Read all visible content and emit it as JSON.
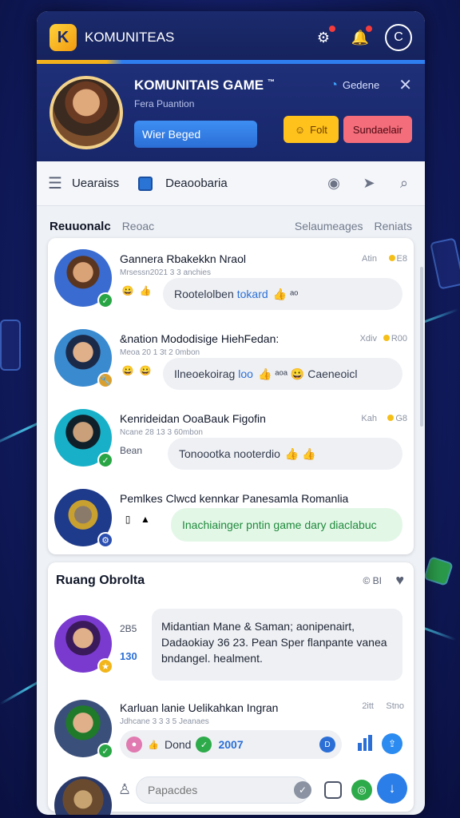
{
  "app": {
    "title": "KOMUNITEAS",
    "logo_icon": "game-logo-icon",
    "top_icons": [
      "settings-icon",
      "notification-icon",
      "profile-circle-icon"
    ],
    "profile_circle_glyph": "C"
  },
  "profile": {
    "name": "KOMUNITAIS GAME",
    "name_mark": "™",
    "subtitle": "Fera Puantion",
    "field_value": "Wier Beged",
    "status_label": "Gedene",
    "follow_label": "Folt",
    "subscribe_label": "Sundaelair",
    "colors": {
      "follow": "#ffc21c",
      "subscribe": "#f46d7a",
      "field": "#2b6fd6"
    }
  },
  "nav": {
    "label1": "Uearaiss",
    "label2": "Deaoobaria",
    "icons": [
      "hamburger-icon",
      "book-icon",
      "shield-icon",
      "pin-icon",
      "search-icon"
    ]
  },
  "subtabs": {
    "active": "Reuuonalc",
    "second": "Reoac",
    "right1": "Selaumeages",
    "right2": "Reniats"
  },
  "posts": [
    {
      "title": "Gannera Rbakekkn Nraol",
      "subtitle": "Mrsessn2021 3 3 anchies",
      "time": "Atin",
      "count": "E8",
      "reactions": [
        "😀",
        "👍"
      ],
      "text": "Rootelolben",
      "highlight": "tokard",
      "emoji": "👍 ᵃᵒ",
      "badge": "✓"
    },
    {
      "title": "&nation Mododisige HiehFedan:",
      "subtitle": "Meoa 20 1 3t 2 0mbon",
      "time": "Xdiv",
      "count": "R00",
      "reactions": [
        "😀",
        "😀"
      ],
      "text": "Ilneoekoirag",
      "highlight": "loo",
      "emoji": "👍 ᵃᵒᵃ 😀 Caeneoicl",
      "badge": "🔧"
    },
    {
      "title": "Kenrideidan OoaBauk Figofin",
      "subtitle": "Ncane 28 13 3 60mbon",
      "time": "Kah",
      "count": "G8",
      "reactions": [
        "Bean"
      ],
      "text": "Tonoootka nooterdio",
      "highlight": "",
      "emoji": "👍 👍",
      "badge": "✓"
    },
    {
      "title": "Pemlkes    Clwcd kennkar Panesamla Romanlia",
      "subtitle": "",
      "time": "",
      "count": "",
      "reactions": [
        "▯",
        "▲"
      ],
      "text": "Inachiainger pntin game dary diaclabuc",
      "highlight": "",
      "emoji": "",
      "badge": "⚙"
    }
  ],
  "chat": {
    "title": "Ruang Obrolta",
    "meta": "© BI",
    "message": {
      "time": "2B5",
      "number": "130",
      "text": "Midantian Mane & Saman; aonipenairt, Dadaokiay 36 23. Pean Sper flanpante vanea bndangel. healment."
    },
    "message2": {
      "title": "Karluan lanie Uelikahkan Ingran",
      "subtitle": "Jdhcane 3 3 3 5 Jeanaes",
      "time": "2itt",
      "stat": "Stno",
      "bar_text": "Dond",
      "bar_number": "2007",
      "bar_count": "D"
    },
    "composer_placeholder": "Papacdes"
  }
}
